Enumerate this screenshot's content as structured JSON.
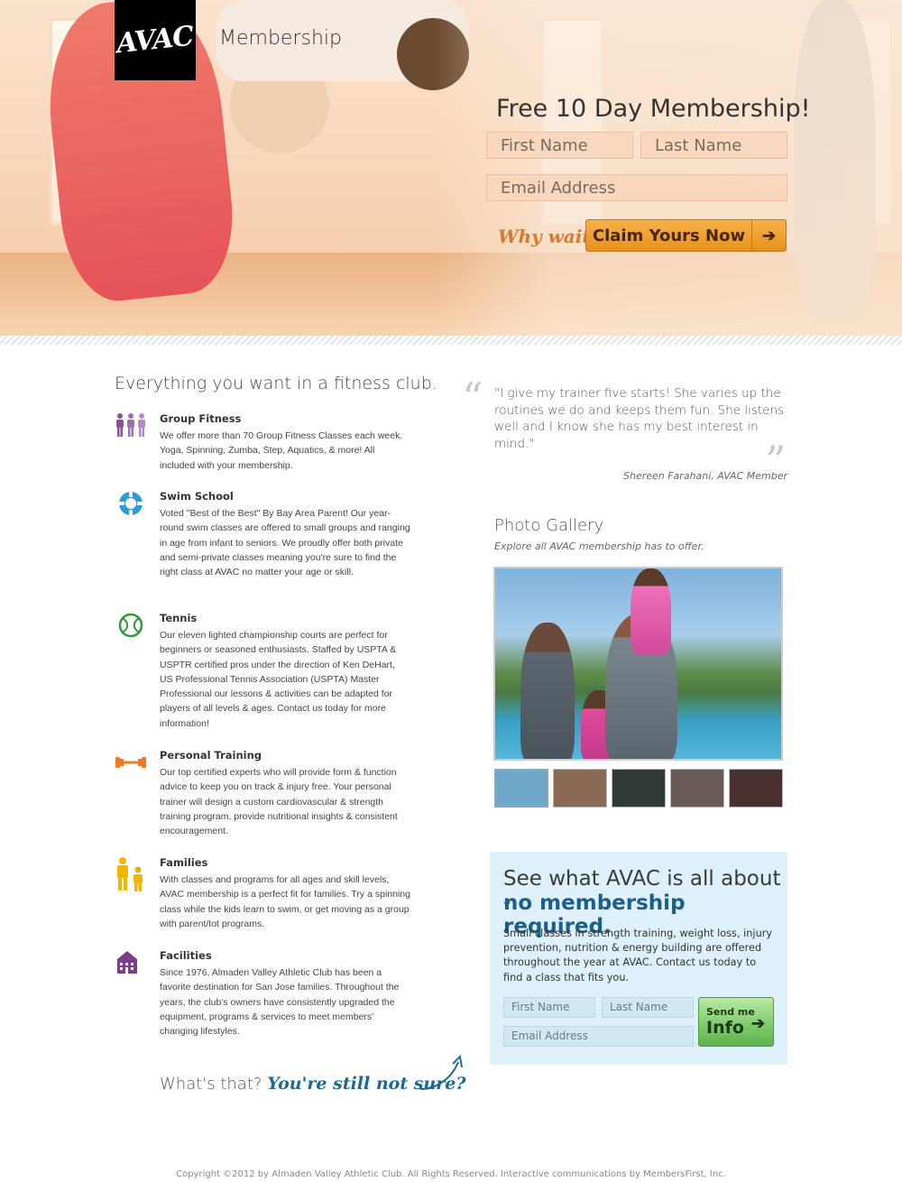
{
  "header": {
    "logo_text": "AVAC",
    "page_label": "Membership"
  },
  "hero_form": {
    "title": "Free 10 Day Membership!",
    "first_name_placeholder": "First Name",
    "last_name_placeholder": "Last Name",
    "email_placeholder": "Email Address",
    "why_wait": "Why wait?",
    "claim_label": "Claim Yours Now",
    "claim_icon": "arrow-right-icon",
    "accent_color": "#e8901c"
  },
  "features": {
    "title": "Everything you want in a fitness club.",
    "items": [
      {
        "title": "Group Fitness",
        "icon": "group-fitness-icon",
        "color": "#8a4f9e",
        "text": "We offer more than 70 Group Fitness Classes each week. Yoga, Spinning, Zumba, Step, Aquatics, & more! All included with your membership."
      },
      {
        "title": "Swim School",
        "icon": "life-ring-icon",
        "color": "#2a9fd6",
        "text": "Voted \"Best of the Best\" By Bay Area Parent! Our year-round swim classes are offered to small groups and ranging in age from infant to seniors. We proudly offer both private and semi-private classes meaning you're sure to find the right class at AVAC no matter your age or skill."
      },
      {
        "title": "Tennis",
        "icon": "tennis-ball-icon",
        "color": "#2f9a3a",
        "text": "Our eleven lighted championship courts are perfect for beginners or seasoned enthusiasts. Staffed by USPTA & USPTR certified pros under the direction of Ken DeHart, US Professional Tennis Association (USPTA) Master Professional our lessons & activities can be adapted for players of all levels & ages. Contact us today for more information!"
      },
      {
        "title": "Personal Training",
        "icon": "dumbbell-icon",
        "color": "#f07a1e",
        "text": "Our top certified experts who will provide form & function advice to keep you on track & injury free. Your personal trainer will design a custom cardiovascular & strength training program, provide nutritional insights & consistent encouragement."
      },
      {
        "title": "Families",
        "icon": "family-icon",
        "color": "#f2b600",
        "text": "With classes and programs for all ages and skill levels, AVAC membership is a perfect fit for families. Try a spinning class while the kids learn to swim, or get moving as a group with parent/tot programs."
      },
      {
        "title": "Facilities",
        "icon": "building-icon",
        "color": "#7a3f8a",
        "text": "Since 1976, Almaden Valley Athletic Club has been a favorite destination for San Jose families. Throughout the years, the club's owners have consistently upgraded the equipment, programs & services to meet members' changing lifestyles."
      }
    ],
    "not_sure_prefix": "What's that?",
    "not_sure_script": "You're still not sure?"
  },
  "testimonial": {
    "quote": "\"I give my trainer five starts! She varies up the routines we do and keeps them fun. She listens well and I know she has my best interest in mind.\"",
    "author": "Shereen Farahani, AVAC Member"
  },
  "gallery": {
    "title": "Photo Gallery",
    "subtitle": "Explore all AVAC membership has to offer.",
    "thumbs": [
      {
        "color": "#6fa7c9",
        "selected": true
      },
      {
        "color": "#8a6a55",
        "selected": false
      },
      {
        "color": "#2f3a36",
        "selected": false
      },
      {
        "color": "#6a5a55",
        "selected": false
      },
      {
        "color": "#4a3030",
        "selected": false
      }
    ]
  },
  "cta": {
    "line1": "See what AVAC is all about -",
    "line2": "no membership required.",
    "body": "Small classes in strength training, weight loss, injury prevention, nutrition & energy building are offered throughout the year at AVAC. Contact us today to find a class that fits you.",
    "first_name_placeholder": "First Name",
    "last_name_placeholder": "Last Name",
    "email_placeholder": "Email Address",
    "send_small": "Send me",
    "send_big": "Info",
    "send_icon": "arrow-right-icon"
  },
  "footer": {
    "text": "Copyright ©2012 by Almaden Valley Athletic Club. All Rights Reserved. Interactive communications by MembersFirst, Inc."
  }
}
